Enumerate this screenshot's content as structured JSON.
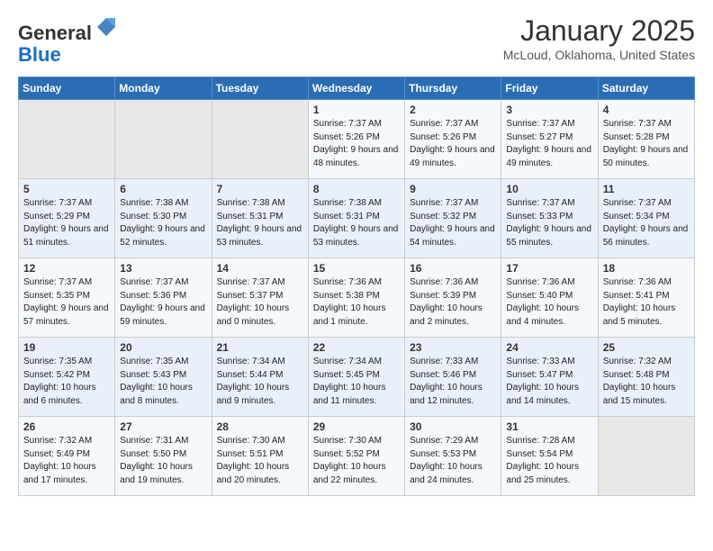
{
  "header": {
    "logo_line1": "General",
    "logo_line2": "Blue",
    "month_title": "January 2025",
    "location": "McLoud, Oklahoma, United States"
  },
  "days_of_week": [
    "Sunday",
    "Monday",
    "Tuesday",
    "Wednesday",
    "Thursday",
    "Friday",
    "Saturday"
  ],
  "weeks": [
    [
      {
        "day": "",
        "empty": true
      },
      {
        "day": "",
        "empty": true
      },
      {
        "day": "",
        "empty": true
      },
      {
        "day": "1",
        "sunrise": "7:37 AM",
        "sunset": "5:26 PM",
        "daylight": "9 hours and 48 minutes."
      },
      {
        "day": "2",
        "sunrise": "7:37 AM",
        "sunset": "5:26 PM",
        "daylight": "9 hours and 49 minutes."
      },
      {
        "day": "3",
        "sunrise": "7:37 AM",
        "sunset": "5:27 PM",
        "daylight": "9 hours and 49 minutes."
      },
      {
        "day": "4",
        "sunrise": "7:37 AM",
        "sunset": "5:28 PM",
        "daylight": "9 hours and 50 minutes."
      }
    ],
    [
      {
        "day": "5",
        "sunrise": "7:37 AM",
        "sunset": "5:29 PM",
        "daylight": "9 hours and 51 minutes."
      },
      {
        "day": "6",
        "sunrise": "7:38 AM",
        "sunset": "5:30 PM",
        "daylight": "9 hours and 52 minutes."
      },
      {
        "day": "7",
        "sunrise": "7:38 AM",
        "sunset": "5:31 PM",
        "daylight": "9 hours and 53 minutes."
      },
      {
        "day": "8",
        "sunrise": "7:38 AM",
        "sunset": "5:31 PM",
        "daylight": "9 hours and 53 minutes."
      },
      {
        "day": "9",
        "sunrise": "7:37 AM",
        "sunset": "5:32 PM",
        "daylight": "9 hours and 54 minutes."
      },
      {
        "day": "10",
        "sunrise": "7:37 AM",
        "sunset": "5:33 PM",
        "daylight": "9 hours and 55 minutes."
      },
      {
        "day": "11",
        "sunrise": "7:37 AM",
        "sunset": "5:34 PM",
        "daylight": "9 hours and 56 minutes."
      }
    ],
    [
      {
        "day": "12",
        "sunrise": "7:37 AM",
        "sunset": "5:35 PM",
        "daylight": "9 hours and 57 minutes."
      },
      {
        "day": "13",
        "sunrise": "7:37 AM",
        "sunset": "5:36 PM",
        "daylight": "9 hours and 59 minutes."
      },
      {
        "day": "14",
        "sunrise": "7:37 AM",
        "sunset": "5:37 PM",
        "daylight": "10 hours and 0 minutes."
      },
      {
        "day": "15",
        "sunrise": "7:36 AM",
        "sunset": "5:38 PM",
        "daylight": "10 hours and 1 minute."
      },
      {
        "day": "16",
        "sunrise": "7:36 AM",
        "sunset": "5:39 PM",
        "daylight": "10 hours and 2 minutes."
      },
      {
        "day": "17",
        "sunrise": "7:36 AM",
        "sunset": "5:40 PM",
        "daylight": "10 hours and 4 minutes."
      },
      {
        "day": "18",
        "sunrise": "7:36 AM",
        "sunset": "5:41 PM",
        "daylight": "10 hours and 5 minutes."
      }
    ],
    [
      {
        "day": "19",
        "sunrise": "7:35 AM",
        "sunset": "5:42 PM",
        "daylight": "10 hours and 6 minutes."
      },
      {
        "day": "20",
        "sunrise": "7:35 AM",
        "sunset": "5:43 PM",
        "daylight": "10 hours and 8 minutes."
      },
      {
        "day": "21",
        "sunrise": "7:34 AM",
        "sunset": "5:44 PM",
        "daylight": "10 hours and 9 minutes."
      },
      {
        "day": "22",
        "sunrise": "7:34 AM",
        "sunset": "5:45 PM",
        "daylight": "10 hours and 11 minutes."
      },
      {
        "day": "23",
        "sunrise": "7:33 AM",
        "sunset": "5:46 PM",
        "daylight": "10 hours and 12 minutes."
      },
      {
        "day": "24",
        "sunrise": "7:33 AM",
        "sunset": "5:47 PM",
        "daylight": "10 hours and 14 minutes."
      },
      {
        "day": "25",
        "sunrise": "7:32 AM",
        "sunset": "5:48 PM",
        "daylight": "10 hours and 15 minutes."
      }
    ],
    [
      {
        "day": "26",
        "sunrise": "7:32 AM",
        "sunset": "5:49 PM",
        "daylight": "10 hours and 17 minutes."
      },
      {
        "day": "27",
        "sunrise": "7:31 AM",
        "sunset": "5:50 PM",
        "daylight": "10 hours and 19 minutes."
      },
      {
        "day": "28",
        "sunrise": "7:30 AM",
        "sunset": "5:51 PM",
        "daylight": "10 hours and 20 minutes."
      },
      {
        "day": "29",
        "sunrise": "7:30 AM",
        "sunset": "5:52 PM",
        "daylight": "10 hours and 22 minutes."
      },
      {
        "day": "30",
        "sunrise": "7:29 AM",
        "sunset": "5:53 PM",
        "daylight": "10 hours and 24 minutes."
      },
      {
        "day": "31",
        "sunrise": "7:28 AM",
        "sunset": "5:54 PM",
        "daylight": "10 hours and 25 minutes."
      },
      {
        "day": "",
        "empty": true
      }
    ]
  ]
}
